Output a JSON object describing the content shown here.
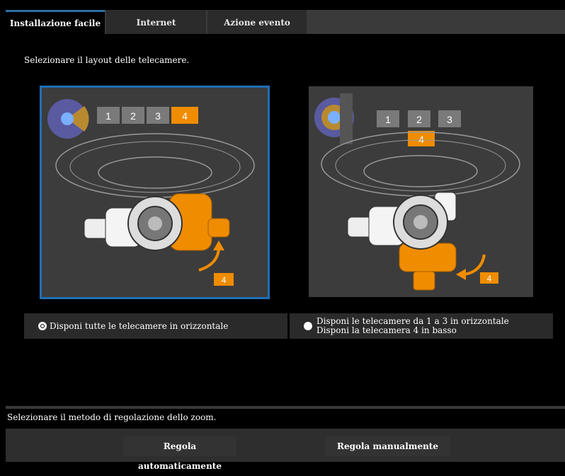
{
  "tabs": [
    {
      "label": "Installazione facile",
      "active": true
    },
    {
      "label": "Internet",
      "active": false
    },
    {
      "label": "Azione evento",
      "active": false
    }
  ],
  "instruction": "Selezionare il layout delle telecamere.",
  "layouts": {
    "horizontal": {
      "numbers": [
        "1",
        "2",
        "3",
        "4"
      ],
      "badge": "4",
      "option_label": "Disponi tutte le telecamere in orizzontale",
      "selected": true
    },
    "vertical": {
      "numbers": [
        "1",
        "2",
        "3"
      ],
      "below_number": "4",
      "badge": "4",
      "option_line1": "Disponi le telecamere da 1 a 3 in orizzontale",
      "option_line2": "Disponi la telecamera 4 in basso",
      "selected": false
    }
  },
  "zoom": {
    "label": "Selezionare il metodo di regolazione dello zoom.",
    "auto_button": "Regola automaticamente",
    "manual_button": "Regola manualmente"
  },
  "colors": {
    "accent": "#f08c00",
    "selection_border": "#1f6fb5",
    "tab_active_border": "#2e6fa3"
  }
}
